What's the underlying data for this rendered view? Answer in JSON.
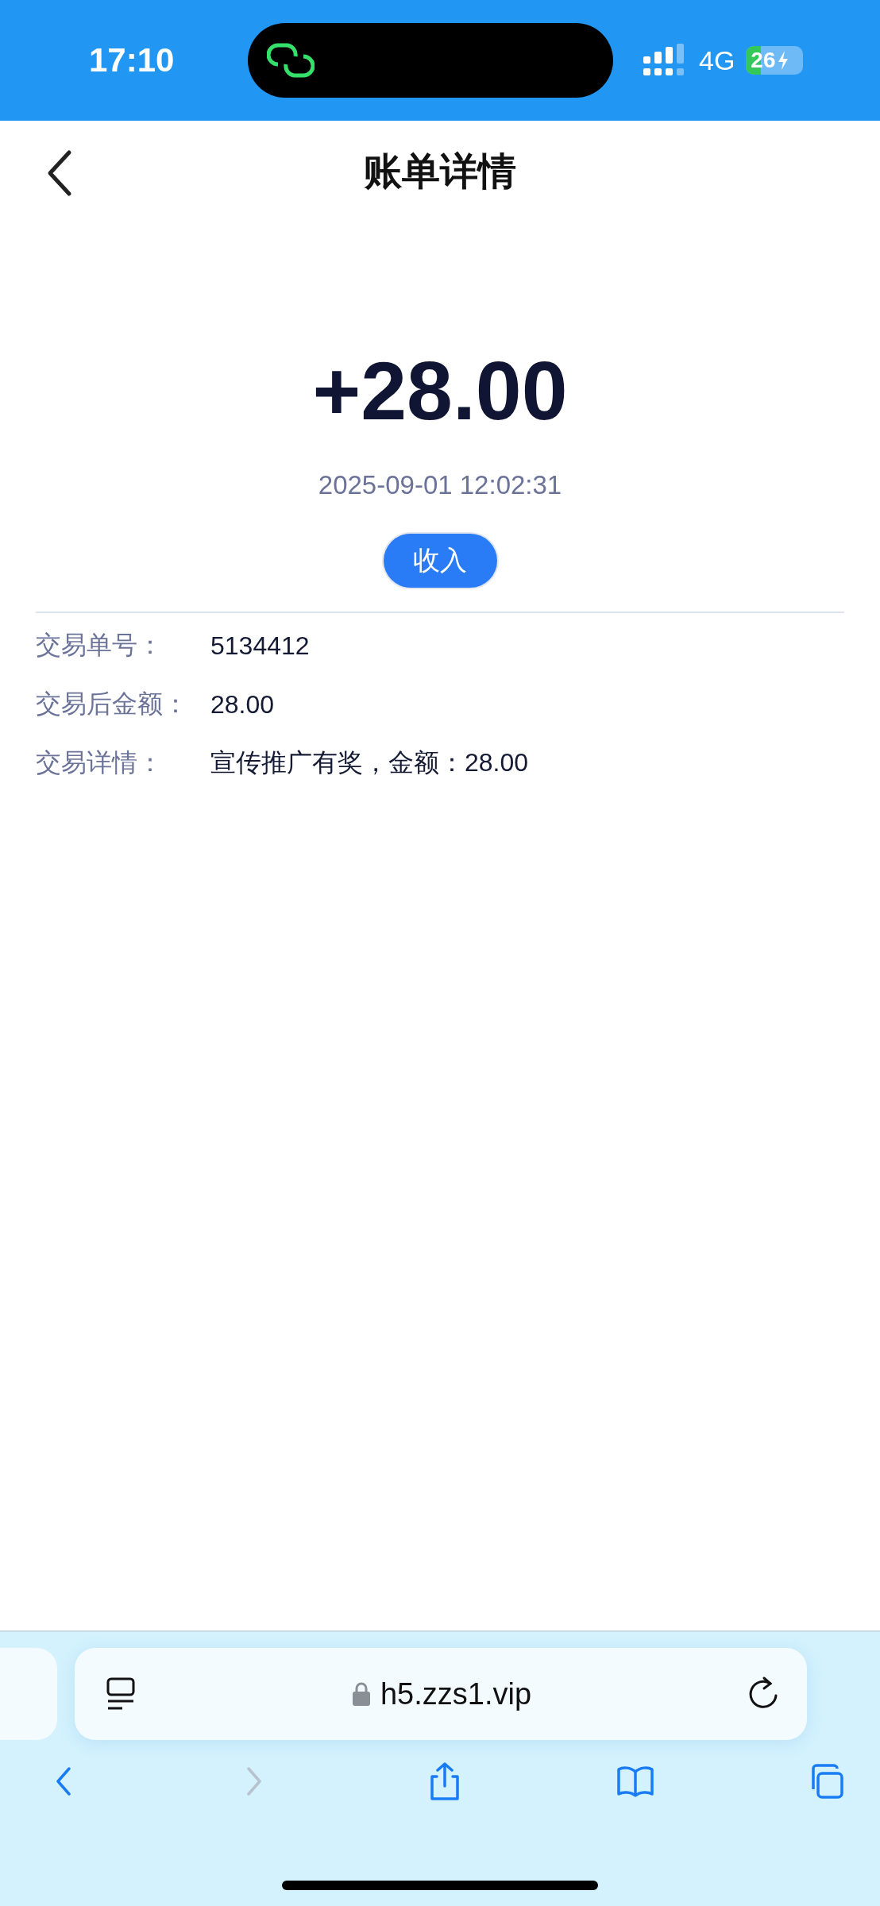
{
  "status_bar": {
    "time": "17:10",
    "network": "4G",
    "battery": "26"
  },
  "nav": {
    "title": "账单详情"
  },
  "summary": {
    "amount": "+28.00",
    "datetime": "2025-09-01 12:02:31",
    "type": "收入"
  },
  "details": [
    {
      "label": "交易单号：",
      "value": "5134412"
    },
    {
      "label": "交易后金额：",
      "value": "28.00"
    },
    {
      "label": "交易详情：",
      "value": "宣传推广有奖，金额：28.00"
    }
  ],
  "browser": {
    "url": "h5.zzs1.vip",
    "toolbar": [
      {
        "kind": "back",
        "disabled": false
      },
      {
        "kind": "forward",
        "disabled": true
      },
      {
        "kind": "share",
        "disabled": false
      },
      {
        "kind": "bookmarks",
        "disabled": false
      },
      {
        "kind": "tabs",
        "disabled": false
      }
    ]
  }
}
